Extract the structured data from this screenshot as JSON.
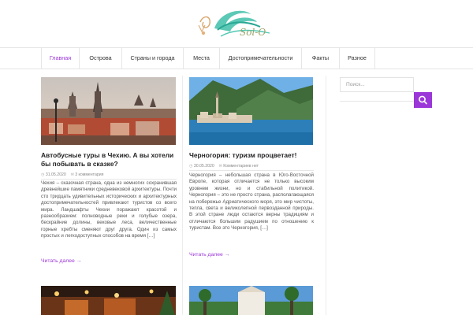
{
  "site": {
    "logo_text": "Sol-O"
  },
  "nav": {
    "items": [
      {
        "label": "Главная",
        "active": true
      },
      {
        "label": "Острова"
      },
      {
        "label": "Страны и города"
      },
      {
        "label": "Места"
      },
      {
        "label": "Достопримечательности"
      },
      {
        "label": "Факты"
      },
      {
        "label": "Разное"
      }
    ]
  },
  "posts": [
    {
      "title": "Автобусные туры в Чехию. А вы хотели бы побывать в сказке?",
      "date": "31.05.2020",
      "comments": "3 комментария",
      "excerpt": "Чехия – сказочная страна, одна из немногих сохранившая древнейшие памятники средневековой архитектуры. Почти сто тридцать удивительных исторических и архитектурных достопримечательностей привлекают туристов со всего мира. Ландшафты Чехии поражают красотой и разнообразием: полноводные реки и голубые озера, бескрайние долины, вековые леса, величественные горные хребты сменяют друг друга. Один из самых простых и легкодоступных способов на время […]",
      "read_more": "Читать далее →"
    },
    {
      "title": "Черногория: туризм процветает!",
      "date": "30.05.2020",
      "comments": "Комментариев нет",
      "excerpt": "Черногория – небольшая страна в Юго-Восточной Европе, которая отличается не только высоким уровнем жизни, но и стабильной политикой. Черногория – это не просто страна, располагающаяся на побережье Адриатического моря, это мир чистоты, тепла, света и великолепной первозданной природы. В этой стране люди остаются верны традициям и отличаются большим радушием по отношению к туристам. Все это Черногория, […]",
      "read_more": "Читать далее →"
    }
  ],
  "sidebar": {
    "search_placeholder": "Поиск..."
  },
  "colors": {
    "accent": "#9b37d8"
  },
  "icons": {
    "search": "search-icon",
    "date": "clock-icon",
    "comments": "comment-icon"
  }
}
